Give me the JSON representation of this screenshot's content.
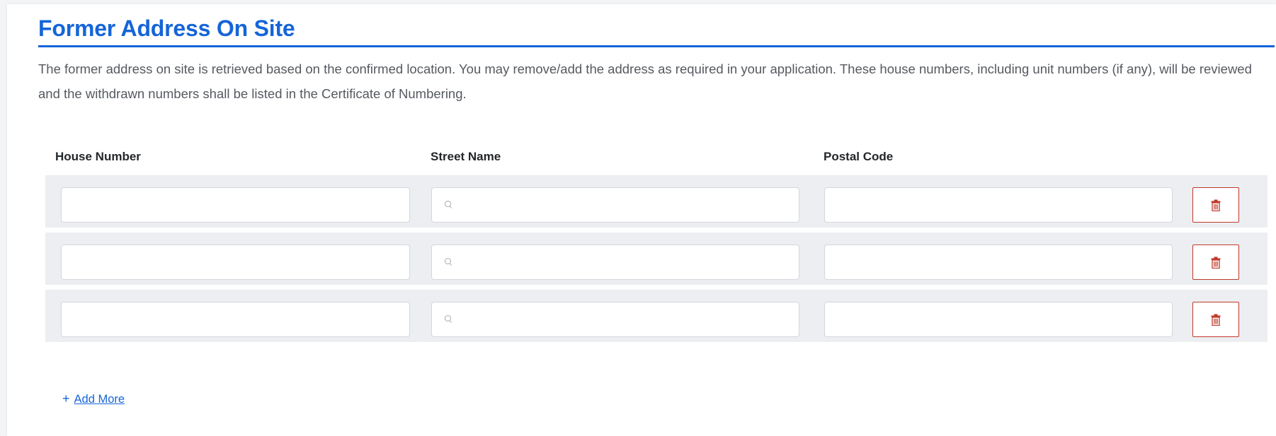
{
  "section": {
    "title": "Former Address On Site",
    "description": "The former address on site is retrieved based on the confirmed location. You may remove/add the address as required in your application. These house numbers, including unit numbers (if any), will be reviewed and the withdrawn numbers shall be listed in the Certificate of Numbering."
  },
  "table": {
    "columns": [
      "House Number",
      "Street Name",
      "Postal Code"
    ],
    "rows": [
      {
        "house_number": "",
        "street_name": "",
        "postal_code": ""
      },
      {
        "house_number": "",
        "street_name": "",
        "postal_code": ""
      },
      {
        "house_number": "",
        "street_name": "",
        "postal_code": ""
      }
    ],
    "street_icon": "search-icon",
    "delete_icon": "trash-icon"
  },
  "add_more": {
    "prefix": "+",
    "label": "Add More"
  },
  "colors": {
    "accent": "#1565d8",
    "delete": "#c0392b",
    "row_background": "#eceef1"
  }
}
